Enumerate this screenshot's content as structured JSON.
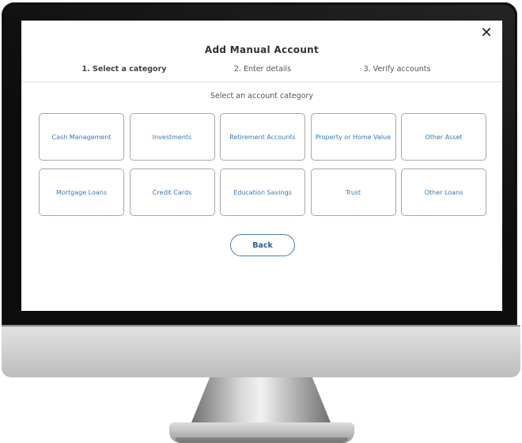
{
  "dialog": {
    "title": "Add Manual Account",
    "close_glyph": "✕",
    "steps": [
      {
        "label": "1. Select a category",
        "active": true
      },
      {
        "label": "2. Enter details",
        "active": false
      },
      {
        "label": "3. Verify accounts",
        "active": false
      }
    ],
    "subtitle": "Select an account category",
    "categories": [
      "Cash Management",
      "Investments",
      "Retirement Accounts",
      "Property or Home Value",
      "Other Asset",
      "Mortgage Loans",
      "Credit Cards",
      "Education Savings",
      "Trust",
      "Other Loans"
    ],
    "back_label": "Back"
  },
  "colors": {
    "accent": "#3a78b8",
    "button_border": "#4a7cae",
    "tile_border": "#a8a8a8",
    "bezel": "#0c0c0c"
  }
}
